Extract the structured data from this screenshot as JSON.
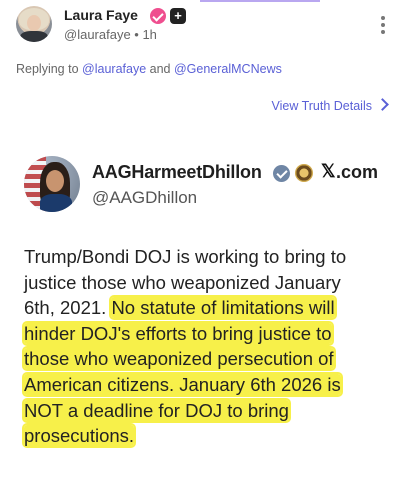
{
  "post": {
    "display_name": "Laura Faye",
    "plus_badge": "+",
    "handle_time": "@laurafaye • 1h",
    "replying_prefix": "Replying to",
    "reply_mention_1": "@laurafaye",
    "reply_and": "and",
    "reply_mention_2": "@GeneralMCNews",
    "view_details": "View Truth Details",
    "icons": [
      "verified-badge-icon",
      "plus-badge-icon",
      "more-options-icon",
      "chevron-right-icon"
    ]
  },
  "embed": {
    "name": "AAGHarmeetDhillon",
    "x_logo": "𝕏",
    "domain": ".com",
    "handle": "@AAGDhillon",
    "icons": [
      "verified-badge-icon",
      "seal-icon",
      "x-logo-icon"
    ],
    "text_lines": [
      {
        "plain": "Trump/Bondi DOJ is working to bring to",
        "highlight": ""
      },
      {
        "plain": "justice those who weaponized January",
        "highlight": ""
      },
      {
        "plain": "6th, 2021. ",
        "highlight": "No statute of limitations will"
      },
      {
        "plain": "",
        "highlight": "hinder DOJ's efforts to bring  justice to"
      },
      {
        "plain": "",
        "highlight": "those who weaponized persecution of"
      },
      {
        "plain": "",
        "highlight": "American citizens. January 6th 2026 is"
      },
      {
        "plain": "",
        "highlight": "NOT a deadline for DOJ to bring"
      },
      {
        "plain": "",
        "highlight": "prosecutions."
      }
    ]
  },
  "colors": {
    "accent": "#5a60d6",
    "highlight": "#f7f04a",
    "verified_pink": "#ef4f8f"
  }
}
